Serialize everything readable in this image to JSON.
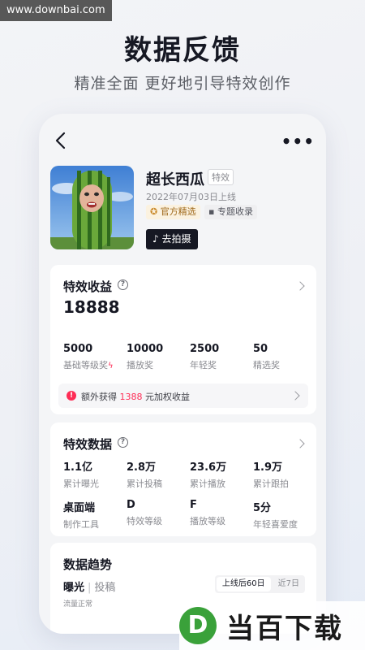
{
  "watermark": {
    "site": "www.downbai.com",
    "brand_letter": "D",
    "brand_text": "当百下载"
  },
  "header": {
    "headline": "数据反馈",
    "subline": "精准全面 更好地引导特效创作"
  },
  "nav": {
    "more": "•••"
  },
  "effect": {
    "name": "超长西瓜",
    "tag": "特效",
    "date": "2022年07月03日上线",
    "badge_official": "官方精选",
    "badge_topic": "专题收录",
    "shoot_label": "去拍摄"
  },
  "revenue": {
    "title": "特效收益",
    "total": "18888",
    "stats": [
      {
        "value": "5000",
        "label": "基础等级奖"
      },
      {
        "value": "10000",
        "label": "播放奖"
      },
      {
        "value": "2500",
        "label": "年轻奖"
      },
      {
        "value": "50",
        "label": "精选奖"
      }
    ],
    "extra": {
      "prefix": "额外获得",
      "amount": "1388",
      "suffix": "元加权收益"
    }
  },
  "effect_data": {
    "title": "特效数据",
    "row1": [
      {
        "value": "1.1亿",
        "label": "累计曝光"
      },
      {
        "value": "2.8万",
        "label": "累计投稿"
      },
      {
        "value": "23.6万",
        "label": "累计播放"
      },
      {
        "value": "1.9万",
        "label": "累计跟拍"
      }
    ],
    "row2": [
      {
        "value": "桌面端",
        "label": "制作工具"
      },
      {
        "value": "D",
        "label": "特效等级"
      },
      {
        "value": "F",
        "label": "播放等级"
      },
      {
        "value": "5分",
        "label": "年轻喜爱度"
      }
    ]
  },
  "trend": {
    "title": "数据趋势",
    "tab_active": "曝光",
    "tab_inactive": "投稿",
    "range_active": "上线后60日",
    "range_inactive": "近7日",
    "status": "流量正常"
  },
  "colors": {
    "accent": "#fe2c55",
    "dark": "#161823",
    "gold": "#a06a1c"
  }
}
